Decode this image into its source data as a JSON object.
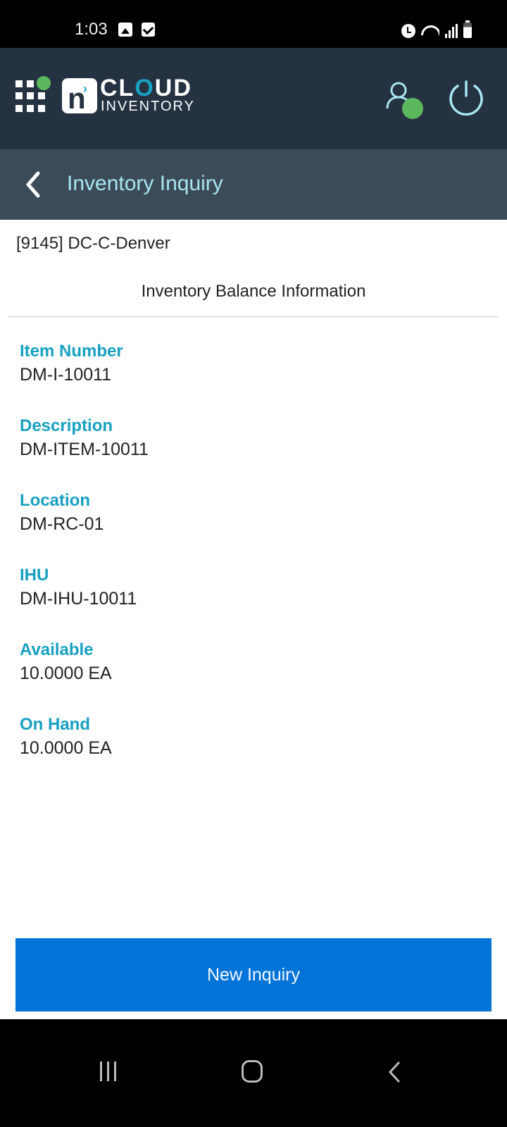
{
  "status_bar": {
    "time": "1:03",
    "left_icons": [
      "image-icon",
      "checkbox-icon"
    ],
    "right_icons": [
      "alarm-icon",
      "wifi-icon",
      "signal-icon",
      "battery-icon"
    ]
  },
  "app_header": {
    "logo": {
      "mark": "n",
      "line1": "CLOUD",
      "line2": "INVENTORY"
    },
    "apps_icon": "apps-grid-icon",
    "user_icon": "user-icon",
    "user_status_color": "#5cb85c",
    "power_icon": "power-icon"
  },
  "nav": {
    "back_icon": "chevron-left-icon",
    "title": "Inventory Inquiry"
  },
  "content": {
    "warehouse": "[9145] DC-C-Denver",
    "section_title": "Inventory Balance Information",
    "fields": [
      {
        "label": "Item Number",
        "value": "DM-I-10011"
      },
      {
        "label": "Description",
        "value": "DM-ITEM-10011"
      },
      {
        "label": "Location",
        "value": "DM-RC-01"
      },
      {
        "label": "IHU",
        "value": "DM-IHU-10011"
      },
      {
        "label": "Available",
        "value": "10.0000 EA"
      },
      {
        "label": "On Hand",
        "value": "10.0000 EA"
      }
    ]
  },
  "actions": {
    "new_inquiry_label": "New Inquiry"
  },
  "colors": {
    "header_bg": "#253242",
    "nav_bg": "#3c4b58",
    "label_accent": "#17a0c2",
    "button_bg": "#0274d8",
    "nav_title": "#a9e6f4"
  }
}
